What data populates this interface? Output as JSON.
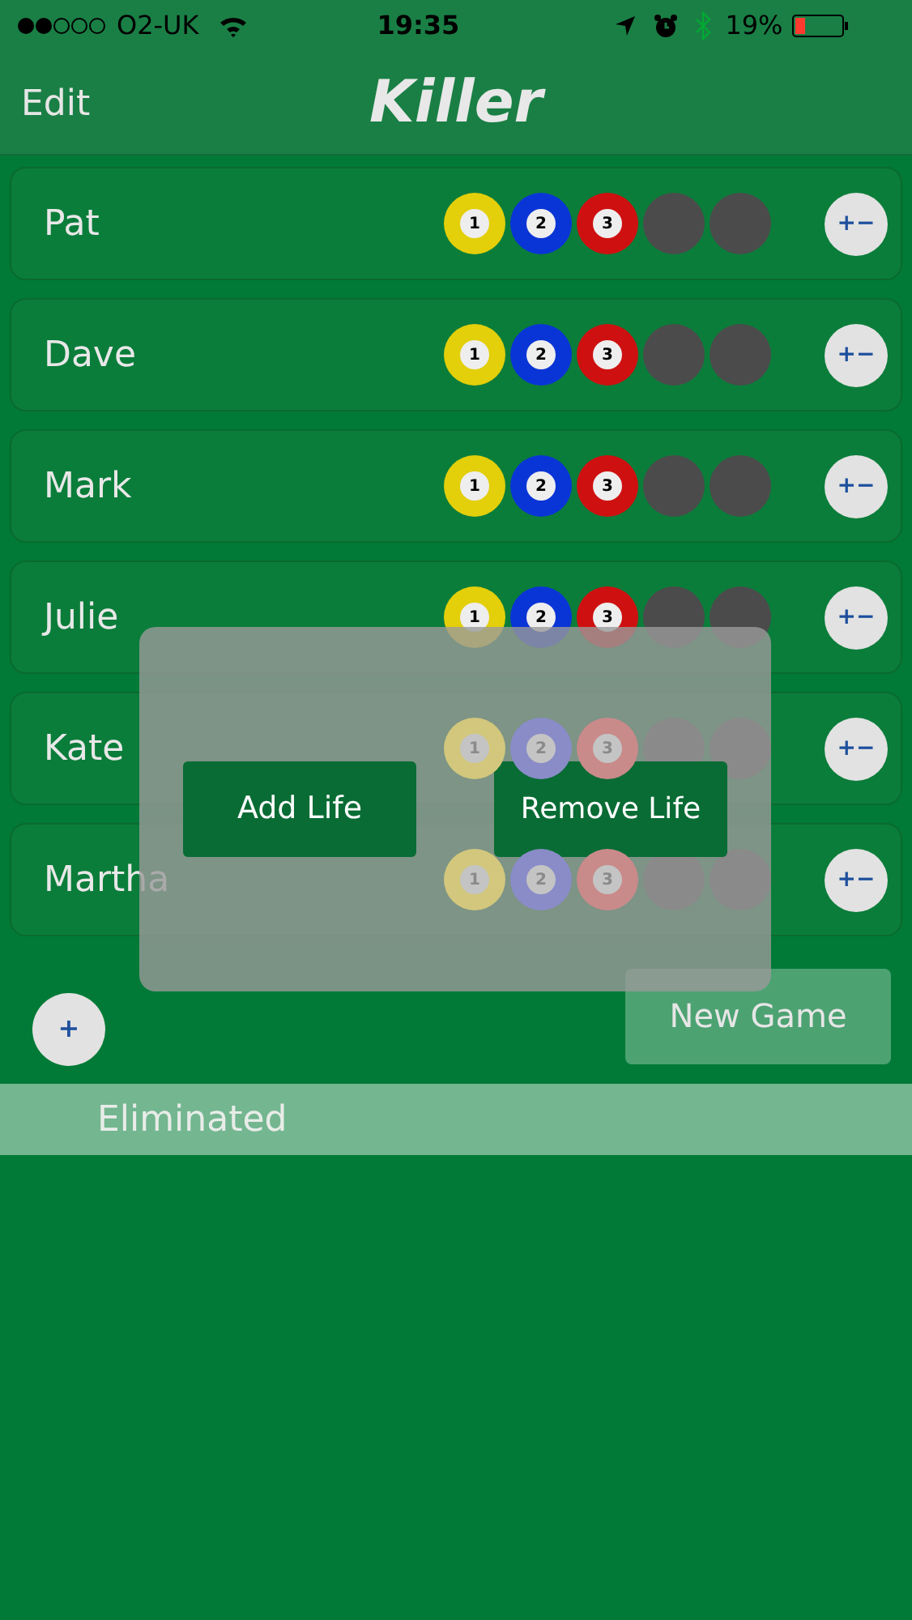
{
  "status_bar": {
    "carrier": "O2-UK",
    "time": "19:35",
    "battery": "19%"
  },
  "nav": {
    "left": "Edit",
    "title": "Killer"
  },
  "players": [
    {
      "name": "Pat",
      "balls": [
        {
          "kind": "ball",
          "label": "1",
          "color": "#e3cf0a"
        },
        {
          "kind": "ball",
          "label": "2",
          "color": "#0a35d6"
        },
        {
          "kind": "ball",
          "label": "3",
          "color": "#cf1010"
        },
        {
          "kind": "empty"
        },
        {
          "kind": "empty"
        }
      ],
      "button": "+−"
    },
    {
      "name": "Dave",
      "balls": [
        {
          "kind": "ball",
          "label": "1",
          "color": "#e3cf0a"
        },
        {
          "kind": "ball",
          "label": "2",
          "color": "#0a35d6"
        },
        {
          "kind": "ball",
          "label": "3",
          "color": "#cf1010"
        },
        {
          "kind": "empty"
        },
        {
          "kind": "empty"
        }
      ],
      "button": "+−"
    },
    {
      "name": "Mark",
      "balls": [
        {
          "kind": "ball",
          "label": "1",
          "color": "#e3cf0a"
        },
        {
          "kind": "ball",
          "label": "2",
          "color": "#0a35d6"
        },
        {
          "kind": "ball",
          "label": "3",
          "color": "#cf1010"
        },
        {
          "kind": "empty"
        },
        {
          "kind": "empty"
        }
      ],
      "button": "+−"
    },
    {
      "name": "Julie",
      "balls": [
        {
          "kind": "ball",
          "label": "1",
          "color": "#e3cf0a"
        },
        {
          "kind": "ball",
          "label": "2",
          "color": "#0a35d6"
        },
        {
          "kind": "ball",
          "label": "3",
          "color": "#cf1010"
        },
        {
          "kind": "empty"
        },
        {
          "kind": "empty"
        }
      ],
      "button": "+−"
    },
    {
      "name": "Kate",
      "balls": [
        {
          "kind": "ball",
          "label": "1",
          "color": "#d2c77c",
          "dimmed": true
        },
        {
          "kind": "ball",
          "label": "2",
          "color": "#8a8cc8",
          "dimmed": true
        },
        {
          "kind": "ball",
          "label": "3",
          "color": "#c98a8a",
          "dimmed": true
        },
        {
          "kind": "empty"
        },
        {
          "kind": "empty"
        }
      ],
      "button": "+−"
    },
    {
      "name": "Martha",
      "balls": [
        {
          "kind": "ball",
          "label": "1",
          "color": "#d2c77c",
          "dimmed": true
        },
        {
          "kind": "ball",
          "label": "2",
          "color": "#8a8cc8",
          "dimmed": true
        },
        {
          "kind": "ball",
          "label": "3",
          "color": "#c98a8a",
          "dimmed": true
        },
        {
          "kind": "empty"
        },
        {
          "kind": "empty"
        }
      ],
      "button": "+−"
    }
  ],
  "add_player": "+",
  "new_game": "New Game",
  "section": "Eliminated",
  "popup": {
    "buttons": [
      "Add Life",
      "Remove Life"
    ]
  }
}
